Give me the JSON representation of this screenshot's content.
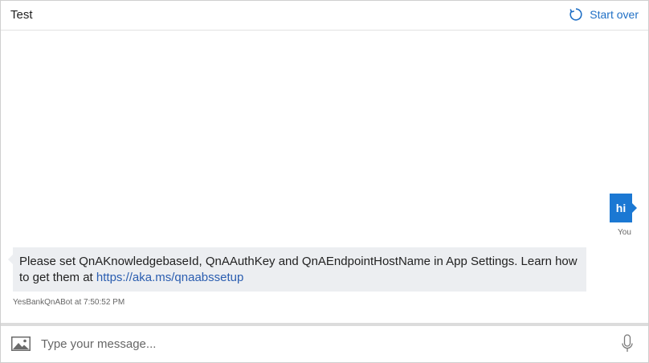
{
  "header": {
    "title": "Test",
    "start_over_label": "Start over",
    "start_over_icon": "refresh-icon",
    "accent_color": "#1f6fc5"
  },
  "messages": {
    "user": {
      "text": "hi",
      "sender_label": "You",
      "bubble_color": "#1b78d3"
    },
    "bot": {
      "text_before_link": "Please set QnAKnowledgebaseId, QnAAuthKey and QnAEndpointHostName in App Settings. Learn how to get them at ",
      "link_text": "https://aka.ms/qnaabssetup",
      "meta": "YesBankQnABot at 7:50:52 PM",
      "bubble_color": "#eceef1"
    }
  },
  "input": {
    "placeholder": "Type your message...",
    "value": "",
    "attach_icon": "image-icon",
    "mic_icon": "microphone-icon"
  }
}
